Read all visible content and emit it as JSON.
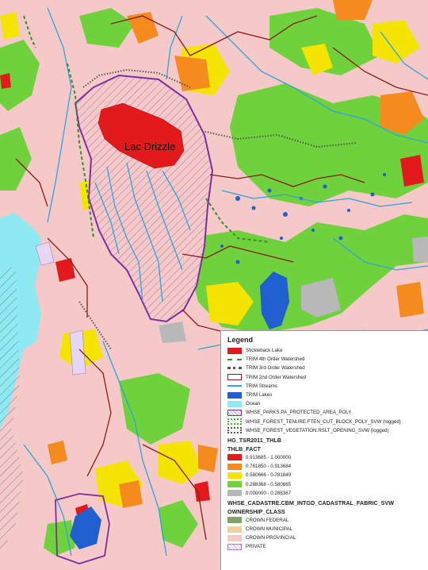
{
  "map": {
    "lake_label": "Lac Drizzle"
  },
  "legend": {
    "title": "Legend",
    "items": [
      {
        "label": "Stickleback Lake",
        "icon": "red-fill-swatch",
        "color": "#e31a1c"
      },
      {
        "label": "TRIM 4th Order Watershed",
        "icon": "green-dashed-line-swatch",
        "color": "#3a8a2e"
      },
      {
        "label": "TRIM 3rd Order Watershed",
        "icon": "dotted-line-swatch",
        "color": "#6b6b6b"
      },
      {
        "label": "TRIM 2nd Order Watershed",
        "icon": "maroon-outline-swatch",
        "color": "#8b1a1a"
      },
      {
        "label": "TRIM Streams",
        "icon": "blue-line-swatch",
        "color": "#2ea3dd"
      },
      {
        "label": "TRIM Lakes",
        "icon": "blue-fill-swatch",
        "color": "#1f5fcf"
      },
      {
        "label": "Ocean",
        "icon": "cyan-fill-swatch",
        "color": "#8eeaf0"
      },
      {
        "label": "WHSE_PARKS.PA_PROTECTED_AREA_POLY",
        "icon": "purple-hatch-swatch",
        "color": "#7b2fa0"
      },
      {
        "label": "WHSE_FOREST_TENURE.FTEN_CUT_BLOCK_POLY_SVW (logged)",
        "icon": "green-dotted-outline-swatch",
        "color": "#4caf3a"
      },
      {
        "label": "WHSE_FOREST_VEGETATION.RSLT_OPENING_SVW (logged)",
        "icon": "grey-dotted-outline-swatch",
        "color": "#555555"
      }
    ],
    "thlb_layer": "HG_TSR2011_THLB",
    "thlb_field": "THLB_FACT",
    "thlb_classes": [
      {
        "label": "0.913685 - 1.000000",
        "color": "#e31a1c"
      },
      {
        "label": "0.781850 - 0.913684",
        "color": "#f58a1f"
      },
      {
        "label": "0.580666 - 0.781849",
        "color": "#f5e400"
      },
      {
        "label": "0.288368 - 0.580665",
        "color": "#6fd13b"
      },
      {
        "label": "0.000000 - 0.288367",
        "color": "#b8b8b8"
      }
    ],
    "cadastre_layer": "WHSE_CADASTRE.CBM_INTGD_CADASTRAL_FABRIC_SVW",
    "ownership_field": "OWNERSHIP_CLASS",
    "ownership_classes": [
      {
        "label": "CROWN FEDERAL",
        "color": "#7fa36b"
      },
      {
        "label": "CROWN MUNICIPAL",
        "color": "#f3cf9b"
      },
      {
        "label": "CROWN PROVINCIAL",
        "color": "#f6c9c9"
      },
      {
        "label": "PRIVATE",
        "color": "#c9a8e0"
      }
    ]
  }
}
